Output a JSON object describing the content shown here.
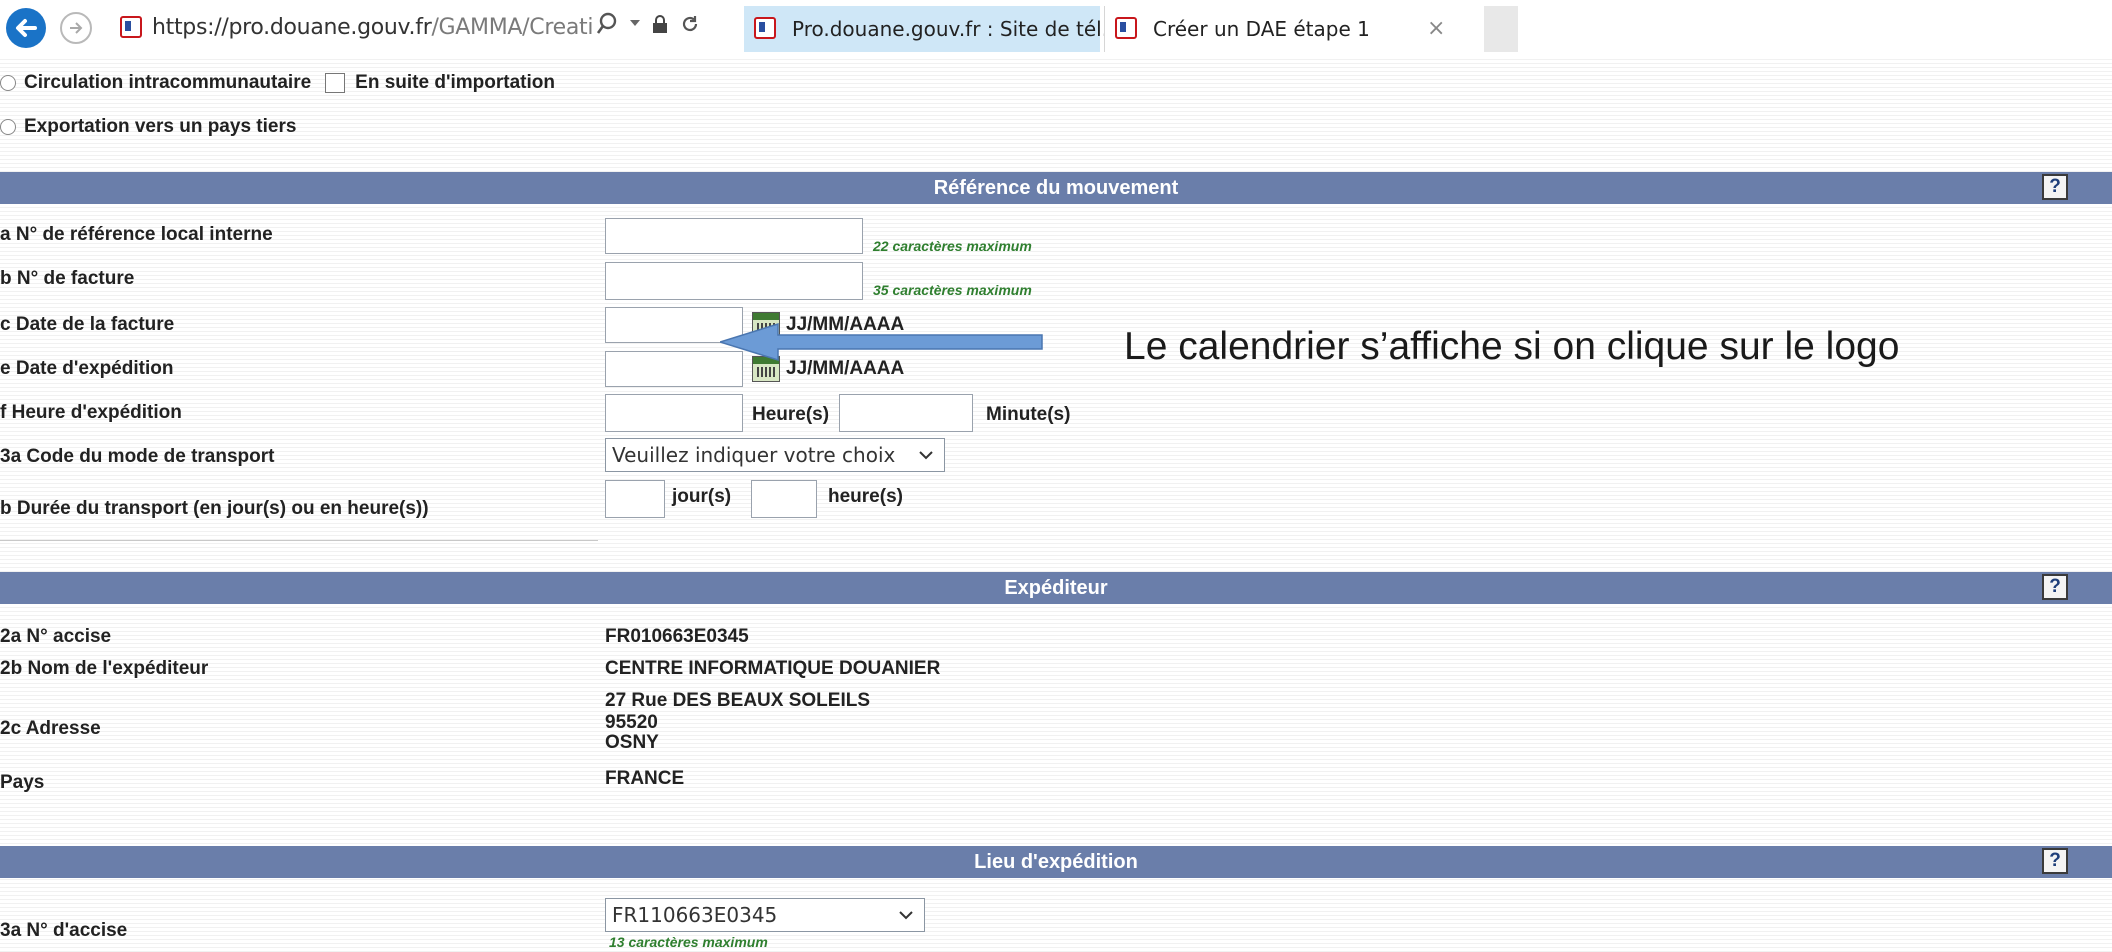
{
  "browser": {
    "url_host": "https://pro.douane.gouv.fr",
    "url_path": "/GAMMA/CreationDaal:",
    "tabs": [
      {
        "label": "Pro.douane.gouv.fr : Site de tél..."
      },
      {
        "label": "Créer un DAE étape 1",
        "close": "×"
      }
    ]
  },
  "options": {
    "intra": "Circulation intracommunautaire",
    "import": "En suite d'importation",
    "export": "Exportation vers un pays tiers"
  },
  "help_label": "?",
  "section_mouvement": {
    "title": "Référence du mouvement",
    "rows": {
      "ref_local": "a N° de référence local interne",
      "facture": "b N° de facture",
      "date_facture": "c Date de la facture",
      "date_expedition": "e Date d'expédition",
      "heure_expedition": "f Heure d'expédition",
      "mode_transport": "3a Code du mode de transport",
      "duree_transport": "b Durée du transport (en jour(s) ou en heure(s))"
    },
    "hint_ref": "22 caractères maximum",
    "hint_facture": "35 caractères maximum",
    "date_format": "JJ/MM/AAAA",
    "heure_label": "Heure(s)",
    "minute_label": "Minute(s)",
    "transport_select": "Veuillez indiquer votre choix",
    "jour_label": "jour(s)",
    "heure_short_label": "heure(s)"
  },
  "annotation": "Le calendrier s’affiche si on clique sur le logo",
  "section_expediteur": {
    "title": "Expéditeur",
    "rows": {
      "accise_label": "2a N° accise",
      "accise_value": "FR010663E0345",
      "nom_label": "2b Nom de l'expéditeur",
      "nom_value": "CENTRE INFORMATIQUE DOUANIER",
      "adresse_label": "2c Adresse",
      "adresse_line1": "27 Rue DES BEAUX SOLEILS",
      "adresse_line2": "95520",
      "adresse_line3": "OSNY",
      "pays_label": "Pays",
      "pays_value": "FRANCE"
    }
  },
  "section_lieu": {
    "title": "Lieu d'expédition",
    "accise_label": "3a N° d'accise",
    "accise_select": "FR110663E0345",
    "hint": "13 caractères maximum"
  }
}
